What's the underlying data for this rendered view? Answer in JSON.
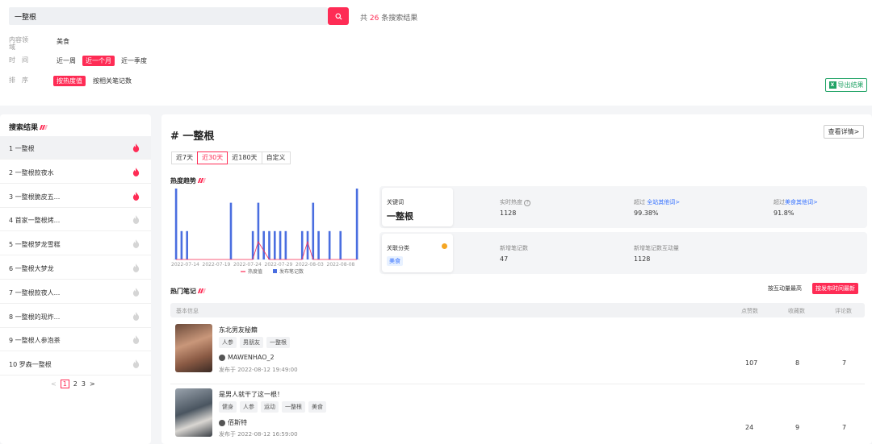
{
  "search": {
    "query": "一整根",
    "count_prefix": "共",
    "count": "26",
    "count_suffix": "条搜索结果"
  },
  "filters": {
    "domain_label": "内容领域",
    "domain_value": "美食",
    "time_label": "时　间",
    "time_options": [
      "近一周",
      "近一个月",
      "近一季度"
    ],
    "time_active": "近一个月",
    "sort_label": "排　序",
    "sort_options": [
      "按热度值",
      "按相关笔记数"
    ],
    "sort_active": "按热度值"
  },
  "export_label": "导出结果",
  "results": {
    "title": "搜索结果",
    "items": [
      {
        "label": "1  一整根",
        "hot": true
      },
      {
        "label": "2  一整根款夜水",
        "hot": true
      },
      {
        "label": "3  一整根脆皮五...",
        "hot": true
      },
      {
        "label": "4  首家一整根烤...",
        "hot": false
      },
      {
        "label": "5  一整根梦龙雪糕",
        "hot": false
      },
      {
        "label": "6  一整根大梦龙",
        "hot": false
      },
      {
        "label": "7  一整根款夜人...",
        "hot": false
      },
      {
        "label": "8  一整根的现炸...",
        "hot": false
      },
      {
        "label": "9  一整根人参泡茶",
        "hot": false
      },
      {
        "label": "10  罗森一整根",
        "hot": false
      }
    ],
    "pages": [
      "1",
      "2",
      "3"
    ],
    "current_page": "1"
  },
  "detail": {
    "title": "# 一整根",
    "view_more": "查看详情>",
    "tabs": [
      "近7天",
      "近30天",
      "近180天",
      "自定义"
    ],
    "active_tab": "近30天",
    "trend_title": "热度趋势",
    "keyword_caption": "关键词",
    "keyword": "一整根",
    "realtime_label": "实时热度",
    "realtime_value": "1128",
    "beat_all_label": "超过",
    "beat_all_link": "全站其他词>",
    "beat_all_value": "99.38%",
    "beat_cat_label": "超过",
    "beat_cat_link": "美食其他词>",
    "beat_cat_value": "91.8%",
    "category_caption": "关联分类",
    "category_tag": "美食",
    "new_notes_label": "新增笔记数",
    "new_notes_value": "47",
    "new_interact_label": "新增笔记数互动量",
    "new_interact_value": "1128",
    "hot_notes_title": "热门笔记",
    "sort_interact": "按互动量最高",
    "sort_time": "按发布时间最新",
    "table_headers": {
      "info": "基本信息",
      "likes": "点赞数",
      "favs": "收藏数",
      "comments": "评论数"
    }
  },
  "notes": [
    {
      "title": "东北男友秘籍",
      "tags": [
        "人参",
        "男朋友",
        "一整根"
      ],
      "author": "MAWENHAO_2",
      "time": "发布于 2022-08-12 19:49:00",
      "likes": "107",
      "favs": "8",
      "comments": "7"
    },
    {
      "title": "是男人就干了这一根！",
      "tags": [
        "健身",
        "人参",
        "运动",
        "一整根",
        "美食"
      ],
      "author": "佰斯特",
      "time": "发布于 2022-08-12 16:59:00",
      "likes": "24",
      "favs": "9",
      "comments": "7"
    }
  ],
  "chart_data": {
    "type": "bar",
    "x_ticks": [
      "2022-07-14",
      "2022-07-19",
      "2022-07-24",
      "2022-07-29",
      "2022-08-03",
      "2022-08-08"
    ],
    "legend": [
      "热度值",
      "发布笔记数"
    ],
    "colors": {
      "heat": "#fe2c55",
      "notes": "#4a6ee0"
    },
    "series": [
      {
        "name": "发布笔记数",
        "values": [
          5,
          2,
          2,
          0,
          0,
          0,
          0,
          0,
          0,
          0,
          4,
          0,
          0,
          0,
          2,
          4,
          2,
          2,
          2,
          2,
          2,
          0,
          0,
          2,
          2,
          4,
          2,
          0,
          2,
          0,
          2,
          0,
          0,
          5
        ]
      },
      {
        "name": "热度值",
        "values": [
          0,
          0,
          0,
          0,
          0,
          0,
          0,
          0,
          0,
          0,
          0,
          0,
          0,
          0,
          0,
          1,
          0.5,
          0,
          0,
          0,
          0,
          0,
          0,
          0,
          1,
          0,
          0,
          0,
          0,
          0,
          0,
          0,
          0,
          0
        ]
      }
    ]
  }
}
